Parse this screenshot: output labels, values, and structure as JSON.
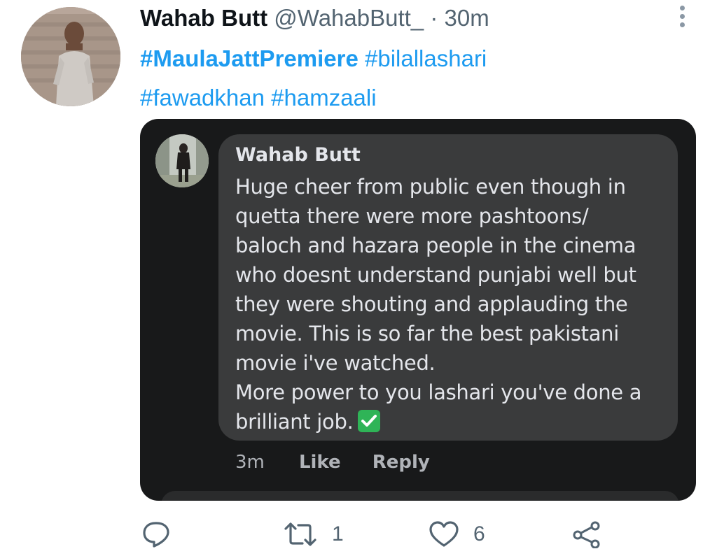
{
  "tweet": {
    "author_name": "Wahab Butt",
    "handle": "@WahabButt_",
    "separator": "·",
    "time": "30m",
    "hashtags": [
      {
        "text": "#MaulaJattPremiere",
        "bold": true
      },
      {
        "text": "#bilallashari",
        "bold": false
      },
      {
        "text": "#fawadkhan",
        "bold": false
      },
      {
        "text": "#hamzaali",
        "bold": false
      }
    ]
  },
  "embedded_comment": {
    "name": "Wahab Butt",
    "lines": [
      "Huge cheer from public even though in",
      "quetta there were more pashtoons/",
      "baloch and hazara people in the cinema",
      "who doesnt understand punjabi well but",
      "they were shouting and applauding the",
      "movie. This is so far the best pakistani",
      "movie i've watched.",
      "More power to you lashari you've done a",
      "brilliant job."
    ],
    "emoji": "check-mark-button-icon",
    "timestamp": "3m",
    "like_label": "Like",
    "reply_label": "Reply"
  },
  "actions": {
    "reply_count": "",
    "retweet_count": "1",
    "like_count": "6"
  },
  "colors": {
    "link": "#1d9bf0",
    "secondary_text": "#536471",
    "dark_bg": "#18191a",
    "bubble_bg": "#3a3b3c",
    "check_green": "#2fb457"
  }
}
